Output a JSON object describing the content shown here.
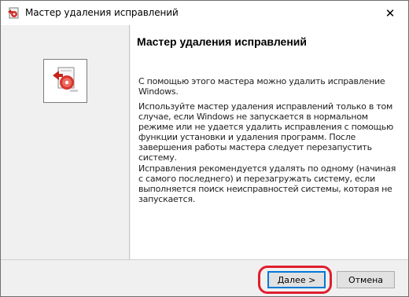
{
  "window": {
    "title": "Мастер удаления исправлений",
    "close_glyph": "✕"
  },
  "content": {
    "heading": "Мастер удаления исправлений",
    "paragraph_1": "С помощью этого мастера можно удалить исправление Windows.",
    "paragraph_2": "Используйте мастер удаления исправлений только в том случае, если Windows не запускается в нормальном режиме или не удается удалить исправления с помощью функции установки и удаления программ. После завершения работы мастера следует перезапустить систему.",
    "paragraph_3": "Исправления рекомендуется удалять по одному (начиная с самого последнего) и перезагружать систему, если выполняется поиск неисправностей системы, которая не запускается."
  },
  "footer": {
    "next_label": "Далее >",
    "cancel_label": "Отмена"
  },
  "icons": {
    "title_icon": "uninstall-wizard-icon",
    "sidebar_icon": "uninstall-package-icon"
  },
  "colors": {
    "highlight": "#e01e2e",
    "default_button_border": "#0078d7"
  }
}
